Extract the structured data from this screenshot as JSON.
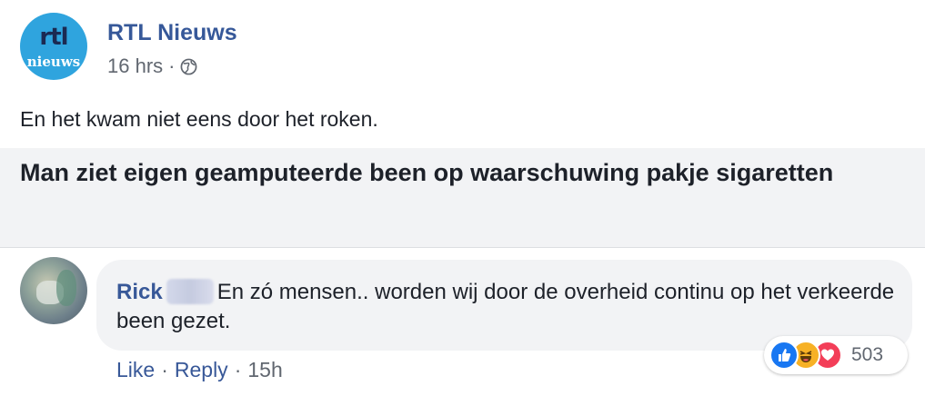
{
  "post": {
    "page_avatar": {
      "logo_main": "rtl",
      "logo_sub": "nieuws"
    },
    "page_name": "RTL Nieuws",
    "time": "16 hrs",
    "separator": "·",
    "audience_icon": "globe-icon",
    "text": "En het kwam niet eens door het roken.",
    "link": {
      "title": "Man ziet eigen geamputeerde been op waarschuwing pakje sigaretten"
    }
  },
  "comment": {
    "author": "Rick",
    "text": "En zó mensen.. worden wij door de overheid continu op het verkeerde been gezet.",
    "actions": {
      "like": "Like",
      "reply": "Reply",
      "time": "15h",
      "separator": "·"
    },
    "reactions": {
      "icons": [
        "like-icon",
        "haha-icon",
        "love-icon"
      ],
      "count": "503"
    }
  },
  "colors": {
    "link_blue": "#365899",
    "meta_gray": "#616770",
    "bubble_bg": "#f2f3f5",
    "rtl_logo_bg": "#2fa4de"
  }
}
